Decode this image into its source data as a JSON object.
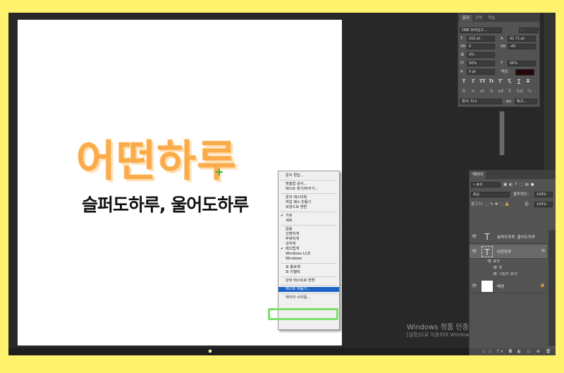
{
  "canvas": {
    "title_text": "어떤하루",
    "subtitle_text": "슬퍼도하루, 울어도하루"
  },
  "context_menu": {
    "items": [
      {
        "label": "문자 편집...",
        "sep_after": true
      },
      {
        "label": "맞춤법 검사...",
        "sep_after": false
      },
      {
        "label": "텍스트 찾기/바꾸기...",
        "sep_after": true
      },
      {
        "label": "문자 래스터화",
        "sep_after": false
      },
      {
        "label": "작업 패스 만들기",
        "sep_after": false
      },
      {
        "label": "모양으로 변환",
        "sep_after": true
      },
      {
        "label": "가로",
        "checked": true,
        "sep_after": false
      },
      {
        "label": "세로",
        "sep_after": true
      },
      {
        "label": "없음",
        "sep_after": false
      },
      {
        "label": "선명하게",
        "sep_after": false
      },
      {
        "label": "뚜렷하게",
        "sep_after": false
      },
      {
        "label": "강하게",
        "sep_after": false
      },
      {
        "label": "매끄럽게",
        "checked": true,
        "sep_after": false
      },
      {
        "label": "Windows LCD",
        "sep_after": false
      },
      {
        "label": "Windows",
        "sep_after": true
      },
      {
        "label": "포 톨토체",
        "sep_after": false
      },
      {
        "label": "포 이탤릭",
        "sep_after": true
      },
      {
        "label": "단락 텍스트로 변환",
        "sep_after": true
      },
      {
        "label": "텍스트 뒤틀기...",
        "highlight": true,
        "sep_after": true
      },
      {
        "label": "레이어 스타일...",
        "sep_after": false
      }
    ]
  },
  "watermark": {
    "title": "Windows 정품 인증",
    "subtitle": "[설정]으로 이동하여 Windows를 정품 인증합니다."
  },
  "character_panel": {
    "tabs": [
      "문자",
      "단락",
      "학습"
    ],
    "font_family": "ONE 모바일고...",
    "font_style": "-",
    "font_size": "102 pt",
    "leading": "91.71 pt",
    "kerning": "0",
    "tracking": "-40",
    "scale_percent": "0%",
    "vertical_scale": "50%",
    "horizontal_scale": "56%",
    "baseline_shift": "0 pt",
    "color_label": "색상:",
    "glyph_buttons": [
      "T",
      "T",
      "TT",
      "Tr",
      "T'",
      "T,",
      "T",
      "T"
    ],
    "ot_buttons": [
      "fi",
      "ơ",
      "st",
      "A",
      "ad",
      "T",
      "1st",
      "½"
    ],
    "language": "영어: 미국",
    "antialias": "매끄...",
    "colors": {
      "text_color": "#220808"
    }
  },
  "layers_panel": {
    "tab": "레이어",
    "filter_label": "종류",
    "blend_mode": "표준",
    "opacity_label": "불투명도:",
    "opacity_value": "100%",
    "lock_label": "잠그기:",
    "fill_label": "칠:",
    "fill_value": "100%",
    "layers": [
      {
        "name": "슬퍼도하루, 울어도하루",
        "type": "text"
      },
      {
        "name": "어떤하루",
        "type": "text",
        "selected": true,
        "fx": "fx"
      },
      {
        "name": "배경",
        "type": "background"
      }
    ],
    "effects_label": "효과",
    "effects": [
      "획",
      "그림자 효과"
    ]
  }
}
